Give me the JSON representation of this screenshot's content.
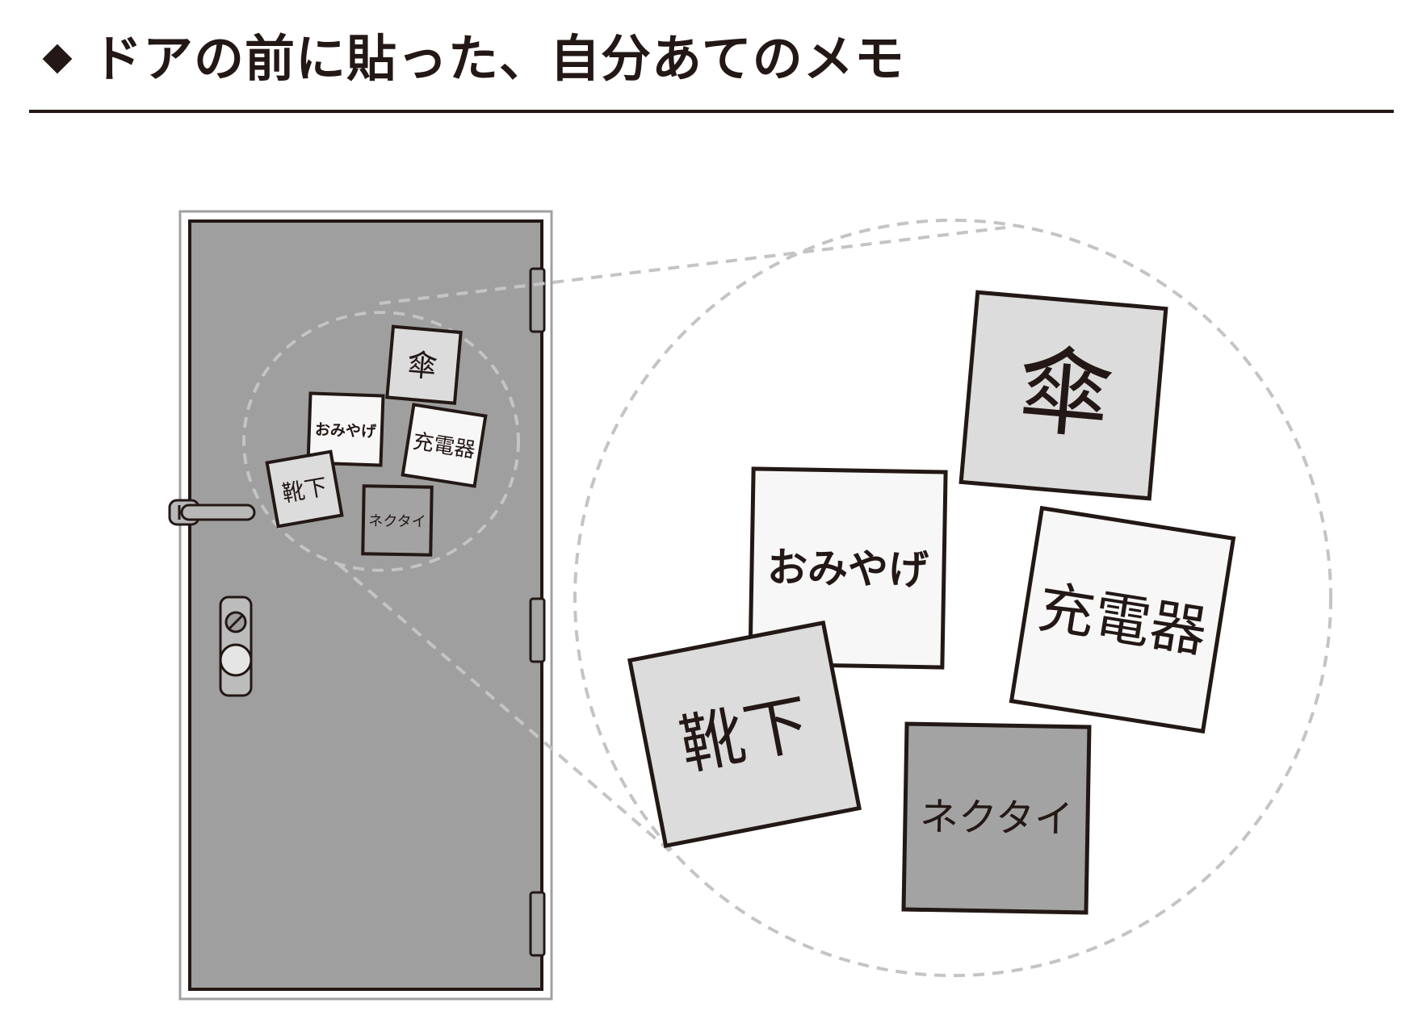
{
  "heading": {
    "bullet_icon": "diamond-bullet-icon",
    "title": "ドアの前に貼った、自分あてのメモ"
  },
  "memos": {
    "umbrella": "傘",
    "souvenir": "おみやげ",
    "charger": "充電器",
    "socks": "靴下",
    "necktie": "ネクタイ"
  },
  "colors": {
    "ink": "#231815",
    "door": "#9f9f9f",
    "door_frame": "#ffffff",
    "memo_light": "#f7f7f7",
    "memo_mid": "#dcdcdc",
    "memo_dark": "#a3a3a3",
    "dashed": "#c4c4c4"
  }
}
